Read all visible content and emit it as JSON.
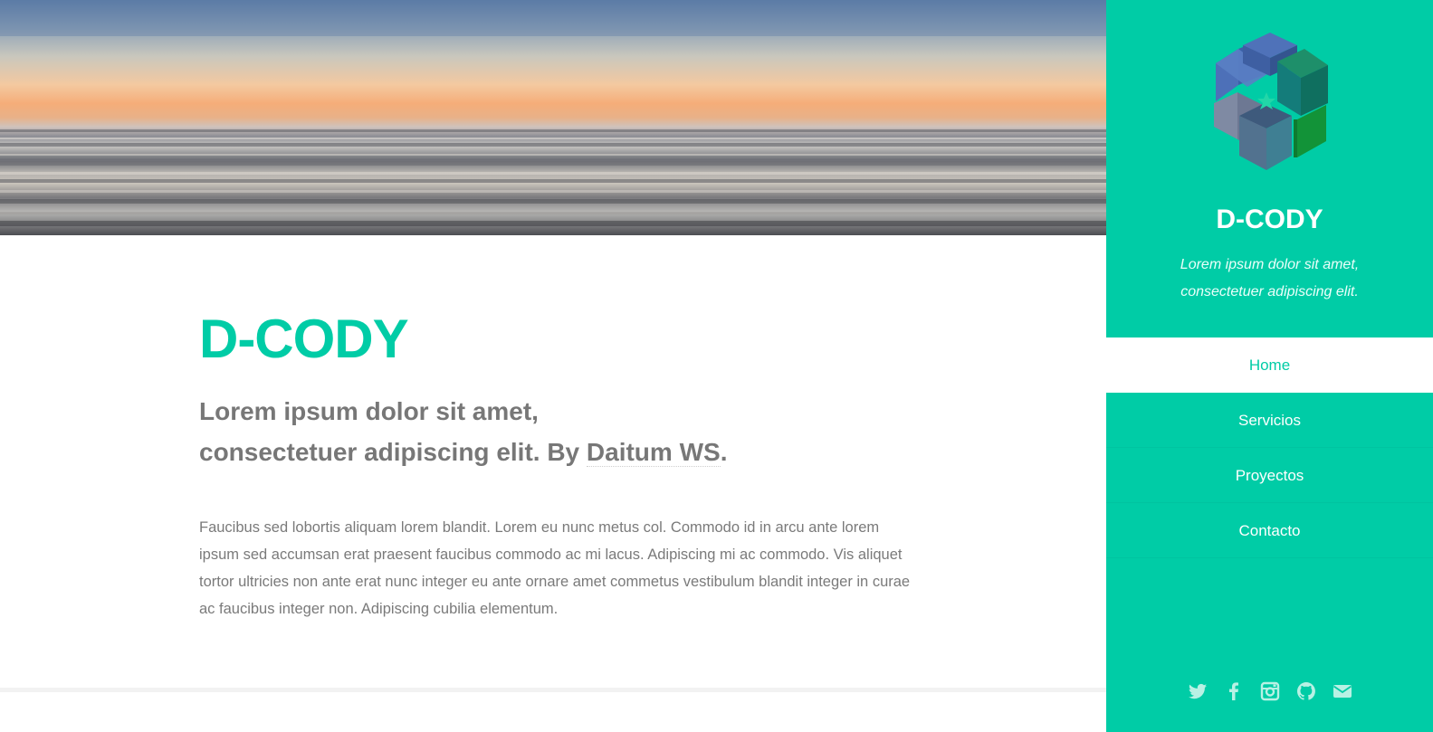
{
  "colors": {
    "accent": "#00cca6",
    "text_muted": "#777777",
    "sidebar_bg": "#00cca6"
  },
  "header": {
    "banner": "sunset-seascape-image"
  },
  "main": {
    "title": "D-CODY",
    "tagline_line1": "Lorem ipsum dolor sit amet,",
    "tagline_line2_prefix": "consectetuer adipiscing elit. By",
    "tagline_link": "Daitum WS",
    "tagline_suffix": ".",
    "body": "Faucibus sed lobortis aliquam lorem blandit. Lorem eu nunc metus col. Commodo id in arcu ante lorem ipsum sed accumsan erat praesent faucibus commodo ac mi lacus. Adipiscing mi ac commodo. Vis aliquet tortor ultricies non ante erat nunc integer eu ante ornare amet commetus vestibulum blandit integer in curae ac faucibus integer non. Adipiscing cubilia elementum."
  },
  "sidebar": {
    "logo": "cube-hexagon-logo",
    "brand": "D-CODY",
    "description_line1": "Lorem ipsum dolor sit amet,",
    "description_line2": "consectetuer adipiscing elit.",
    "nav": [
      {
        "label": "Home",
        "active": true
      },
      {
        "label": "Servicios",
        "active": false
      },
      {
        "label": "Proyectos",
        "active": false
      },
      {
        "label": "Contacto",
        "active": false
      }
    ],
    "social": [
      "twitter-icon",
      "facebook-icon",
      "instagram-icon",
      "github-icon",
      "envelope-icon"
    ]
  }
}
